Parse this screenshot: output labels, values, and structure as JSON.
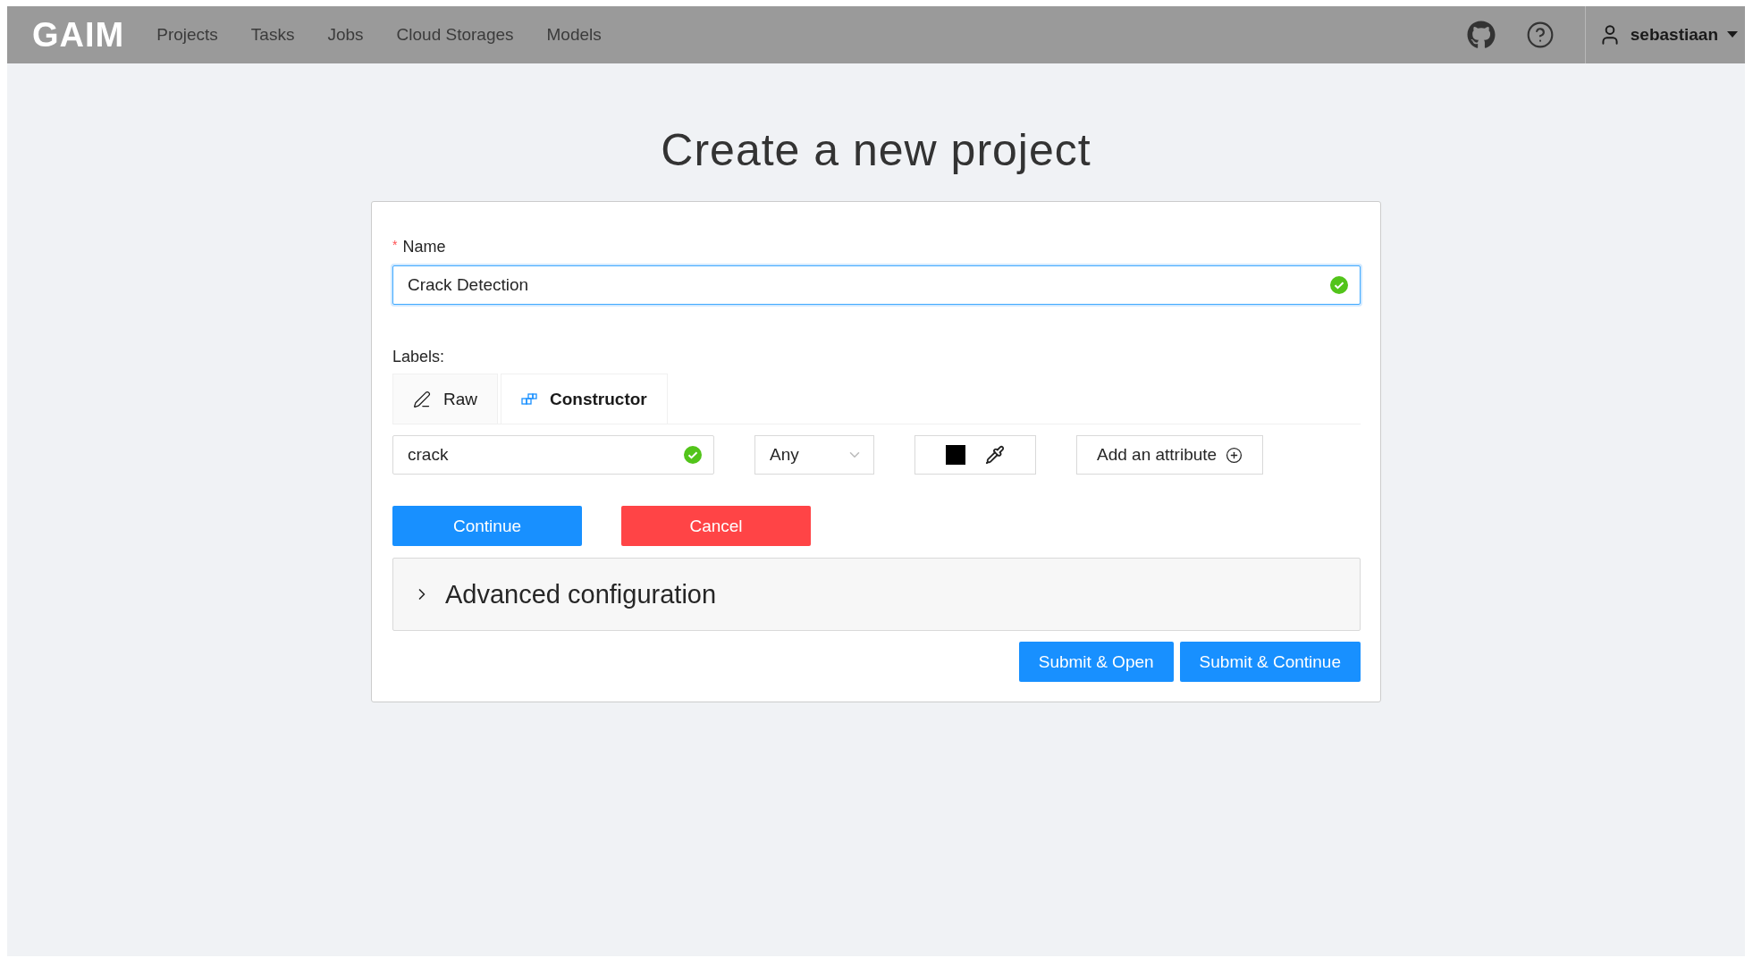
{
  "header": {
    "logo": "GAIM",
    "nav": [
      {
        "label": "Projects"
      },
      {
        "label": "Tasks"
      },
      {
        "label": "Jobs"
      },
      {
        "label": "Cloud Storages"
      },
      {
        "label": "Models"
      }
    ],
    "user": "sebastiaan"
  },
  "title": "Create a new project",
  "name_field": {
    "label": "Name",
    "required": true,
    "required_mark": "*",
    "value": "Crack Detection",
    "valid": true,
    "focused": true
  },
  "labels": {
    "heading": "Labels:",
    "tabs": [
      {
        "label": "Raw",
        "kind": "raw",
        "selected": false
      },
      {
        "label": "Constructor",
        "kind": "constructor",
        "selected": true
      }
    ],
    "label_name": {
      "value": "crack",
      "valid": true
    },
    "type_select": {
      "value": "Any"
    },
    "color": "#000000",
    "add_attribute": "Add an attribute",
    "buttons": [
      {
        "label": "Continue",
        "kind": "primary"
      },
      {
        "label": "Cancel",
        "kind": "danger"
      }
    ]
  },
  "advanced": {
    "title": "Advanced configuration",
    "expanded": false
  },
  "submit_buttons": [
    {
      "label": "Submit & Open"
    },
    {
      "label": "Submit & Continue"
    }
  ]
}
